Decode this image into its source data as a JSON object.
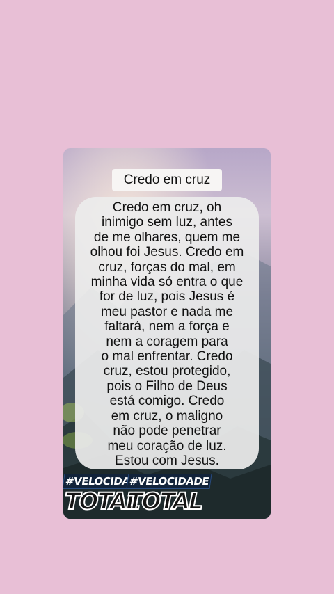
{
  "card": {
    "title": "Credo em cruz",
    "prayer_text": "Credo em cruz, oh\ninimigo sem luz, antes\nde me olhares, quem me\nolhou foi Jesus. Credo em\ncruz, forças do mal, em\nminha vida só entra o que\nfor de luz, pois Jesus é\nmeu pastor e nada me\nfaltará, nem a força e\nnem a coragem para\no mal enfrentar. Credo\ncruz, estou protegido,\npois o Filho de Deus\nestá comigo. Credo\nem cruz, o maligno\nnão pode penetrar\nmeu coração de luz.\nEstou com Jesus."
  },
  "watermark": {
    "tag_left": "#VELOCIDADE",
    "tag_right": "#VELOCIDADE",
    "word_left": "TOTAL",
    "word_right": "TOTAL"
  },
  "colors": {
    "page_background": "#e8bfd6",
    "text_box": "#ececec",
    "watermark_accent": "#2a4d80"
  }
}
